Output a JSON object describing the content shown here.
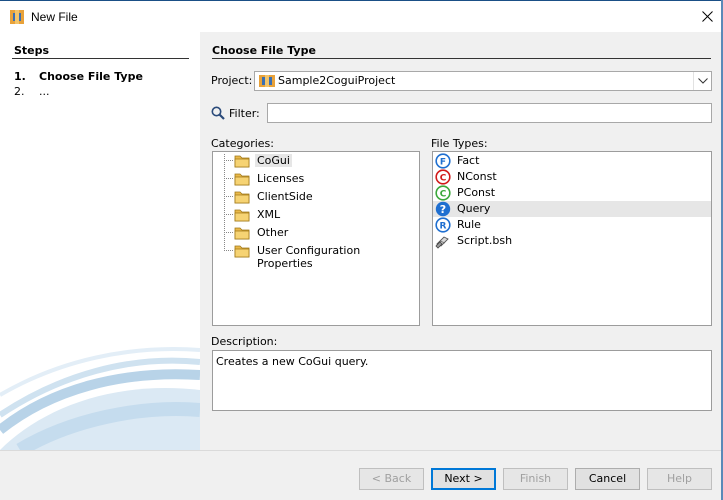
{
  "window": {
    "title": "New File",
    "icon": "netbeans-icon",
    "close_icon": "close-icon"
  },
  "steps": {
    "heading": "Steps",
    "items": [
      {
        "number": "1.",
        "label": "Choose File Type",
        "current": true
      },
      {
        "number": "2.",
        "label": "...",
        "current": false
      }
    ]
  },
  "main": {
    "heading": "Choose File Type",
    "project_label": "Project:",
    "project_value": "Sample2CoguiProject",
    "filter_label": "Filter:",
    "filter_value": "",
    "categories_label": "Categories:",
    "categories": [
      {
        "label": "CoGui",
        "selected": true
      },
      {
        "label": "Licenses",
        "selected": false
      },
      {
        "label": "ClientSide",
        "selected": false
      },
      {
        "label": "XML",
        "selected": false
      },
      {
        "label": "Other",
        "selected": false
      },
      {
        "label": "User Configuration Properties",
        "selected": false
      }
    ],
    "file_types_label": "File Types:",
    "file_types": [
      {
        "label": "Fact",
        "icon": "fact-icon",
        "letter": "F",
        "color": "#1f6fd0",
        "selected": false
      },
      {
        "label": "NConst",
        "icon": "nconst-icon",
        "letter": "C",
        "color": "#d11a1a",
        "selected": false
      },
      {
        "label": "PConst",
        "icon": "pconst-icon",
        "letter": "C",
        "color": "#3aa83a",
        "selected": false
      },
      {
        "label": "Query",
        "icon": "query-icon",
        "letter": "?",
        "color": "#1f6fd0",
        "selected": true
      },
      {
        "label": "Rule",
        "icon": "rule-icon",
        "letter": "R",
        "color": "#1f6fd0",
        "selected": false
      },
      {
        "label": "Script.bsh",
        "icon": "script-icon",
        "letter": "",
        "color": "#666666",
        "selected": false
      }
    ],
    "description_label": "Description:",
    "description": "Creates a new CoGui query."
  },
  "buttons": {
    "back": "< Back",
    "next": "Next >",
    "finish": "Finish",
    "cancel": "Cancel",
    "help": "Help"
  }
}
